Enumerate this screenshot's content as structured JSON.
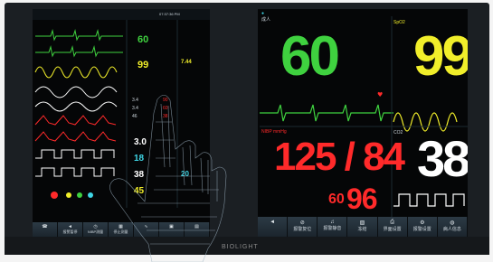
{
  "colors": {
    "hr": "#3fd13f",
    "spo2": "#f1ee2a",
    "nibp": "#ff2a2a",
    "resp": "#ffffff",
    "etco2": "#ffffff",
    "cyan": "#3fd6e6",
    "bezel": "#1b1f23"
  },
  "brand": "BIOLIGHT",
  "monitorA": {
    "time": "07:37:36 PM",
    "hr": "60",
    "spo2": "99",
    "spo2_small": "7.44",
    "val_a": "3.4",
    "val_b": "3.4",
    "val_c": "46",
    "pair_a": "90",
    "pair_b": "60",
    "pair_c": "38",
    "temp": "3.0",
    "resp": "18",
    "etco2": "38",
    "nibp_small": "45",
    "nibp_small2": "20",
    "buttons": [
      {
        "icon": "phone-icon",
        "glyph": "☎",
        "label": ""
      },
      {
        "icon": "sound-icon",
        "glyph": "◄",
        "label": "报警暂停"
      },
      {
        "icon": "clock-icon",
        "glyph": "◷",
        "label": "NIBP测量"
      },
      {
        "icon": "grid-icon",
        "glyph": "▦",
        "label": "停止测量"
      },
      {
        "icon": "wave-icon",
        "glyph": "∿",
        "label": ""
      },
      {
        "icon": "image-icon",
        "glyph": "▣",
        "label": ""
      },
      {
        "icon": "chart-icon",
        "glyph": "▤",
        "label": ""
      }
    ]
  },
  "monitorB": {
    "patient_type": "成人",
    "hr": "60",
    "spo2": "99",
    "spo2_label": "SpO2",
    "nibp": "125 / 84",
    "nibp_label": "NIBP mmHg",
    "nibp_mean": "96",
    "nibp_pr": "60",
    "resp": "38",
    "co2_label": "CO2",
    "buttons": [
      {
        "icon": "back-icon",
        "glyph": "◄",
        "label": ""
      },
      {
        "icon": "alarm-pause-icon",
        "glyph": "⊘",
        "label": "报警复位"
      },
      {
        "icon": "mute-icon",
        "glyph": "♫",
        "label": "报警静音"
      },
      {
        "icon": "freeze-icon",
        "glyph": "▧",
        "label": "冻结"
      },
      {
        "icon": "print-icon",
        "glyph": "⎙",
        "label": "界面设置"
      },
      {
        "icon": "settings-icon",
        "glyph": "⚙",
        "label": "报警设置"
      },
      {
        "icon": "user-icon",
        "glyph": "◍",
        "label": "病人信息"
      }
    ]
  }
}
